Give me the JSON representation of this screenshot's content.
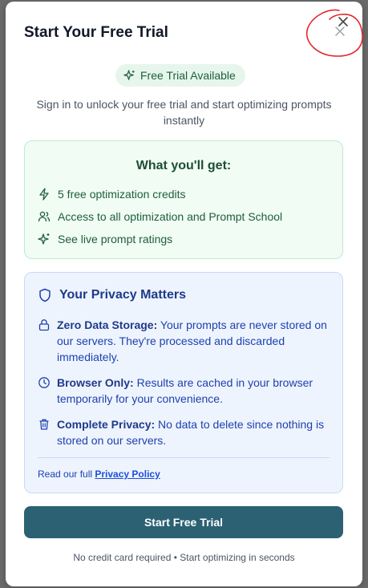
{
  "modal": {
    "title": "Start Your Free Trial",
    "badge": "Free Trial Available",
    "subtitle": "Sign in to unlock your free trial and start optimizing prompts instantly"
  },
  "benefits": {
    "title": "What you'll get:",
    "items": [
      {
        "icon": "lightning-icon",
        "label": "5 free optimization credits"
      },
      {
        "icon": "users-icon",
        "label": "Access to all optimization and Prompt School"
      },
      {
        "icon": "sparkles-icon",
        "label": "See live prompt ratings"
      }
    ]
  },
  "privacy": {
    "title": "Your Privacy Matters",
    "items": [
      {
        "icon": "lock-icon",
        "heading": "Zero Data Storage:",
        "text": " Your prompts are never stored on our servers. They're processed and discarded immediately."
      },
      {
        "icon": "clock-icon",
        "heading": "Browser Only:",
        "text": " Results are cached in your browser temporarily for your convenience."
      },
      {
        "icon": "trash-icon",
        "heading": "Complete Privacy:",
        "text": " No data to delete since nothing is stored on our servers."
      }
    ],
    "policy_prefix": "Read our full ",
    "policy_link": "Privacy Policy"
  },
  "cta": {
    "label": "Start Free Trial"
  },
  "footnote": "No credit card required • Start optimizing in seconds",
  "colors": {
    "cta": "#2b6173",
    "benefits_bg": "#f0fcf4",
    "privacy_bg": "#eef4fe",
    "annotation": "#e3262a"
  }
}
